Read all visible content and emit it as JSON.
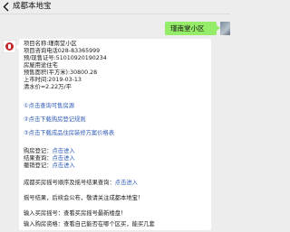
{
  "header": {
    "back_icon": "chevron-left-icon",
    "title": "成都本地宝"
  },
  "user_message": {
    "text": "瑾南堂小区"
  },
  "bot_message": {
    "info_lines": [
      "项目名称:瑾南堂小区",
      "项目咨询电话028-83365999",
      "预/现售证号:5101092019​0234",
      "房屋用途住宅",
      "预售面积(平方米):30800.28",
      "上市时间:2019-03-13",
      "清水价≈2.22万/平"
    ],
    "links": [
      {
        "num": "①",
        "text": "点击查询可售房源"
      },
      {
        "num": "②",
        "text": "点击下载购房登记规则"
      },
      {
        "num": "③",
        "text": "点击下载成品住房装修方案价格表"
      }
    ],
    "register": [
      {
        "label": "购房登记：",
        "action": "点击进入"
      },
      {
        "label": "结果查询：",
        "action": "点击进入"
      },
      {
        "label": "撤销登记：",
        "action": "点击进入"
      }
    ],
    "lottery_line": {
      "prefix": "成都买房摇号顺序及摇号结果查询：",
      "action": "点击进入"
    },
    "footer_lines": [
      "摇号结果，后续会公布，敬请关注成都本地宝！",
      "输入买房摇号：查看买房摇号最新楼盘！",
      "输入购房资格：查看自己能否在哪个区买，能买几套"
    ]
  }
}
